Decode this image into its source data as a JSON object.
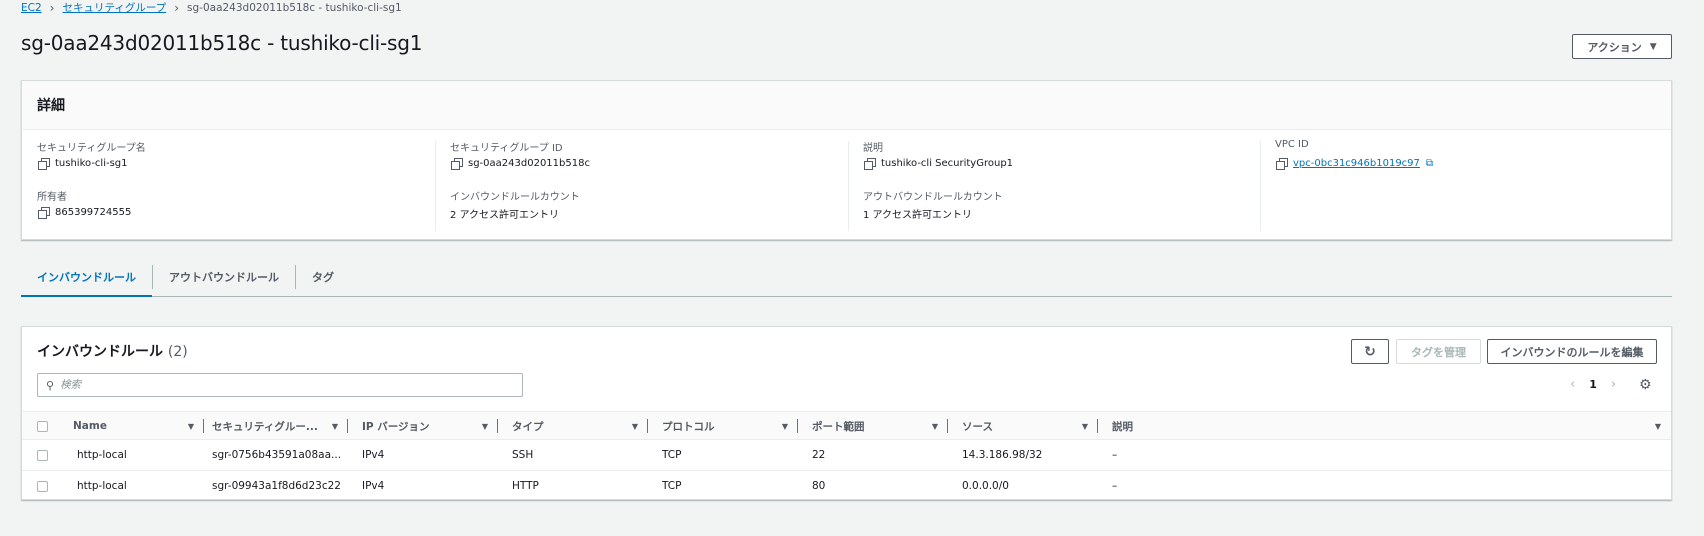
{
  "breadcrumb": {
    "root": "EC2",
    "parent": "セキュリティグループ",
    "current": "sg-0aa243d02011b518c - tushiko-cli-sg1"
  },
  "page_title": "sg-0aa243d02011b518c - tushiko-cli-sg1",
  "actions_button": "アクション",
  "details": {
    "header": "詳細",
    "fields": {
      "sg_name_label": "セキュリティグループ名",
      "sg_name_value": "tushiko-cli-sg1",
      "sg_id_label": "セキュリティグループ ID",
      "sg_id_value": "sg-0aa243d02011b518c",
      "description_label": "説明",
      "description_value": "tushiko-cli SecurityGroup1",
      "vpc_id_label": "VPC ID",
      "vpc_id_value": "vpc-0bc31c946b1019c97",
      "owner_label": "所有者",
      "owner_value": "865399724555",
      "inbound_count_label": "インバウンドルールカウント",
      "inbound_count_value": "2 アクセス許可エントリ",
      "outbound_count_label": "アウトバウンドルールカウント",
      "outbound_count_value": "1 アクセス許可エントリ"
    }
  },
  "tabs": [
    {
      "label": "インバウンドルール",
      "active": true
    },
    {
      "label": "アウトバウンドルール",
      "active": false
    },
    {
      "label": "タグ",
      "active": false
    }
  ],
  "inbound_rules": {
    "title": "インバウンドルール",
    "count": "(2)",
    "manage_tags_button": "タグを管理",
    "edit_button": "インバウンドのルールを編集",
    "search_placeholder": "検索",
    "page_number": "1",
    "columns": [
      "Name",
      "セキュリティグルー...",
      "IP バージョン",
      "タイプ",
      "プロトコル",
      "ポート範囲",
      "ソース",
      "説明"
    ],
    "rows": [
      {
        "name": "http-local",
        "rule_id": "sgr-0756b43591a08aa...",
        "ip_version": "IPv4",
        "type": "SSH",
        "protocol": "TCP",
        "port_range": "22",
        "source": "14.3.186.98/32",
        "description": "–"
      },
      {
        "name": "http-local",
        "rule_id": "sgr-09943a1f8d6d23c22",
        "ip_version": "IPv4",
        "type": "HTTP",
        "protocol": "TCP",
        "port_range": "80",
        "source": "0.0.0.0/0",
        "description": "–"
      }
    ]
  },
  "icons": {
    "copy": "copy-icon",
    "external_link": "external-link-icon",
    "refresh": "refresh-icon",
    "search": "search-icon",
    "settings": "gear-icon"
  },
  "colors": {
    "accent": "#0073bb",
    "background": "#f2f3f3"
  }
}
